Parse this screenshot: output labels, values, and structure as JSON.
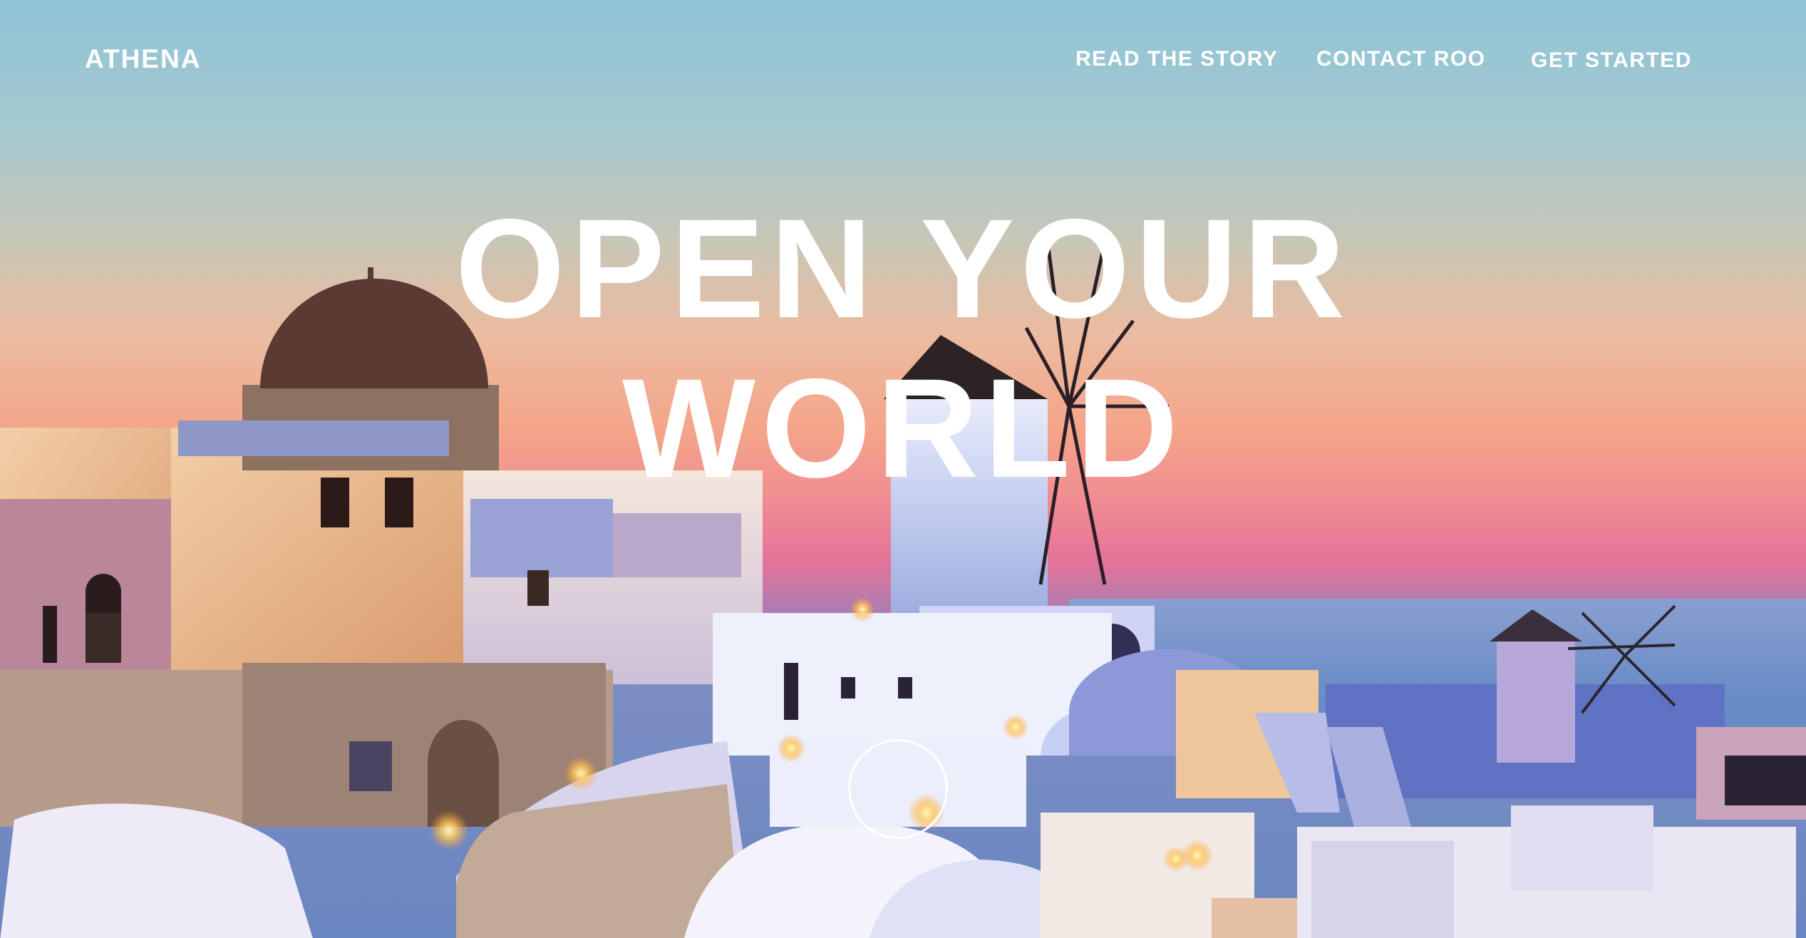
{
  "header": {
    "brand": "ATHENA",
    "nav": [
      {
        "label": "READ THE STORY"
      },
      {
        "label": "CONTACT ROO"
      },
      {
        "label": "GET STARTED"
      }
    ]
  },
  "hero": {
    "headline_line1": "OPEN YOUR",
    "headline_line2": "WORLD"
  },
  "colors": {
    "text": "#ffffff",
    "sky_top": "#8ec3d6",
    "sunset_pink": "#f08a93",
    "sea": "#6f8fc8"
  },
  "icons": {
    "scroll": "scroll-circle-icon"
  }
}
